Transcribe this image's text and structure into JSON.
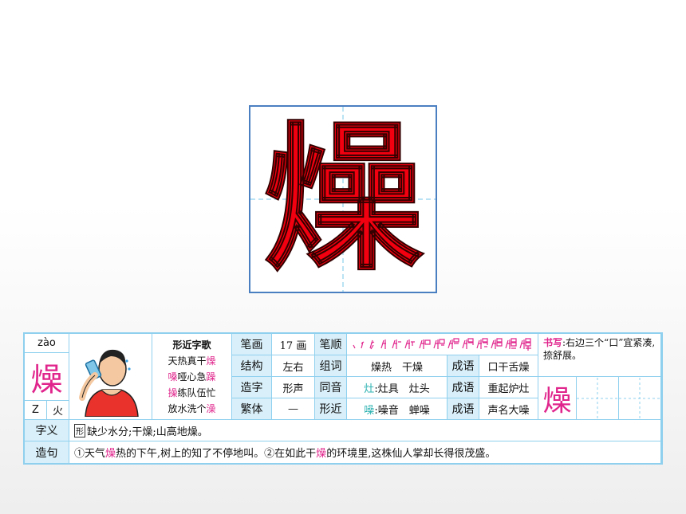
{
  "character": "燥",
  "pinyin": "zào",
  "radical": "火",
  "structure_letter": "Z",
  "song": {
    "title": "形近字歌",
    "lines": [
      {
        "a": "天热真干",
        "b": "燥"
      },
      {
        "a": "嗓",
        "b": "哑心急",
        "c": "躁"
      },
      {
        "a": "操",
        "b": "练队伍忙"
      },
      {
        "a": "放水洗个",
        "b": "澡"
      }
    ]
  },
  "rows": {
    "strokes_label": "笔画",
    "strokes_value": "17 画",
    "order_label": "笔顺",
    "structure_label": "结构",
    "structure_value": "左右",
    "words_label": "组词",
    "words_value": "燥热　干燥",
    "idiom_label": "成语",
    "idiom1": "口干舌燥",
    "formation_label": "造字",
    "formation_value": "形声",
    "homophone_label": "同音",
    "homophone_char": "灶",
    "homophone_words": ":灶具　灶头",
    "idiom2": "重起炉灶",
    "traditional_label": "繁体",
    "traditional_value": "—",
    "similar_label": "形近",
    "similar_char": "噪",
    "similar_words": ":噪音　蝉噪",
    "idiom3": "声名大噪"
  },
  "writing": {
    "label": "书写",
    "text": ":右边三个“口”宜紧凑,捺舒展。"
  },
  "meaning": {
    "label": "字义",
    "tag": "形",
    "text": "缺少水分;干燥;山高地燥。"
  },
  "sentence": {
    "label": "造句",
    "p1": "①天气",
    "c1": "燥",
    "p2": "热的下午,树上的知了不停地叫。②在如此干",
    "c2": "燥",
    "p3": "的环境里,这株仙人掌却长得很茂盛。"
  },
  "colors": {
    "accent": "#e0258c",
    "red": "#f2000f",
    "border": "#8fd0ee",
    "label_bg": "#d9f0fa",
    "frame": "#4a7fc1"
  }
}
